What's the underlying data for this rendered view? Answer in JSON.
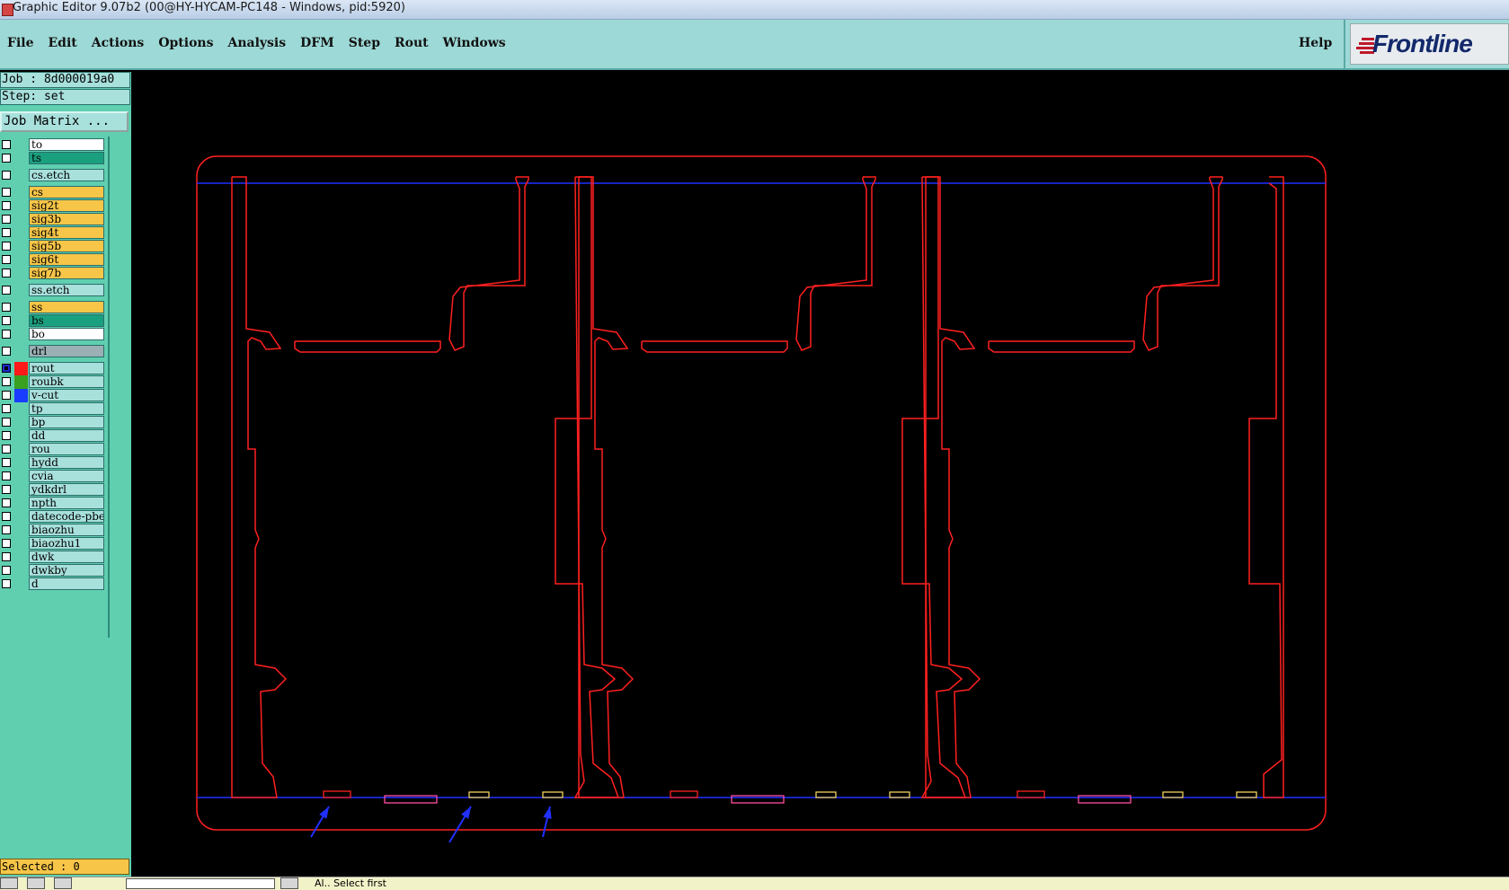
{
  "window": {
    "title": "Graphic Editor 9.07b2 (00@HY-HYCAM-PC148 - Windows, pid:5920)"
  },
  "menu": {
    "items": [
      "File",
      "Edit",
      "Actions",
      "Options",
      "Analysis",
      "DFM",
      "Step",
      "Rout",
      "Windows"
    ],
    "help": "Help"
  },
  "brand": {
    "logo_text": "Frontline",
    "logo_accent_color": "#c0182a",
    "logo_color": "#13296b"
  },
  "job": {
    "job_label": "Job : 8d000019a0",
    "step_label": "Step: set"
  },
  "job_matrix_button": "Job Matrix ...",
  "layers": [
    {
      "name": "to",
      "bg": "#ffffff",
      "color": "",
      "active": false
    },
    {
      "name": "ts",
      "bg": "#1aa07f",
      "color": "",
      "active": false
    },
    {
      "name": "cs.etch",
      "bg": "#a8e0dc",
      "color": "",
      "active": false
    },
    {
      "name": "cs",
      "bg": "#f7c548",
      "color": "",
      "active": false
    },
    {
      "name": "sig2t",
      "bg": "#f7c548",
      "color": "",
      "active": false
    },
    {
      "name": "sig3b",
      "bg": "#f7c548",
      "color": "",
      "active": false
    },
    {
      "name": "sig4t",
      "bg": "#f7c548",
      "color": "",
      "active": false
    },
    {
      "name": "sig5b",
      "bg": "#f7c548",
      "color": "",
      "active": false
    },
    {
      "name": "sig6t",
      "bg": "#f7c548",
      "color": "",
      "active": false
    },
    {
      "name": "sig7b",
      "bg": "#f7c548",
      "color": "",
      "active": false
    },
    {
      "name": "ss.etch",
      "bg": "#a8e0dc",
      "color": "",
      "active": false
    },
    {
      "name": "ss",
      "bg": "#f7c548",
      "color": "",
      "active": false
    },
    {
      "name": "bs",
      "bg": "#1aa07f",
      "color": "",
      "active": false
    },
    {
      "name": "bo",
      "bg": "#ffffff",
      "color": "",
      "active": false
    },
    {
      "name": "drl",
      "bg": "#9ab0b4",
      "color": "",
      "active": false
    },
    {
      "name": "rout",
      "bg": "#a8e0dc",
      "color": "#ff1a1a",
      "active": true
    },
    {
      "name": "roubk",
      "bg": "#a8e0dc",
      "color": "#3aa020",
      "active": false
    },
    {
      "name": "v-cut",
      "bg": "#a8e0dc",
      "color": "#1a3cff",
      "active": false
    },
    {
      "name": "tp",
      "bg": "#a8e0dc",
      "color": "",
      "active": false
    },
    {
      "name": "bp",
      "bg": "#a8e0dc",
      "color": "",
      "active": false
    },
    {
      "name": "dd",
      "bg": "#a8e0dc",
      "color": "",
      "active": false
    },
    {
      "name": "rou",
      "bg": "#a8e0dc",
      "color": "",
      "active": false
    },
    {
      "name": "hydd",
      "bg": "#a8e0dc",
      "color": "",
      "active": false
    },
    {
      "name": "cvia",
      "bg": "#a8e0dc",
      "color": "",
      "active": false
    },
    {
      "name": "ydkdrl",
      "bg": "#a8e0dc",
      "color": "",
      "active": false
    },
    {
      "name": "npth",
      "bg": "#a8e0dc",
      "color": "",
      "active": false
    },
    {
      "name": "datecode-pbe",
      "bg": "#a8e0dc",
      "color": "",
      "active": false
    },
    {
      "name": "biaozhu",
      "bg": "#a8e0dc",
      "color": "",
      "active": false
    },
    {
      "name": "biaozhu1",
      "bg": "#a8e0dc",
      "color": "",
      "active": false
    },
    {
      "name": "dwk",
      "bg": "#a8e0dc",
      "color": "",
      "active": false
    },
    {
      "name": "dwkby",
      "bg": "#a8e0dc",
      "color": "",
      "active": false
    },
    {
      "name": "d",
      "bg": "#a8e0dc",
      "color": "",
      "active": false
    }
  ],
  "status": {
    "selected_label": "Selected : 0"
  },
  "bottom": {
    "message": "Al..  Select first"
  },
  "canvas": {
    "background": "#000000",
    "rout_color": "#ff2020",
    "vcut_color": "#2030ff",
    "pad_color": "#f0d060"
  }
}
